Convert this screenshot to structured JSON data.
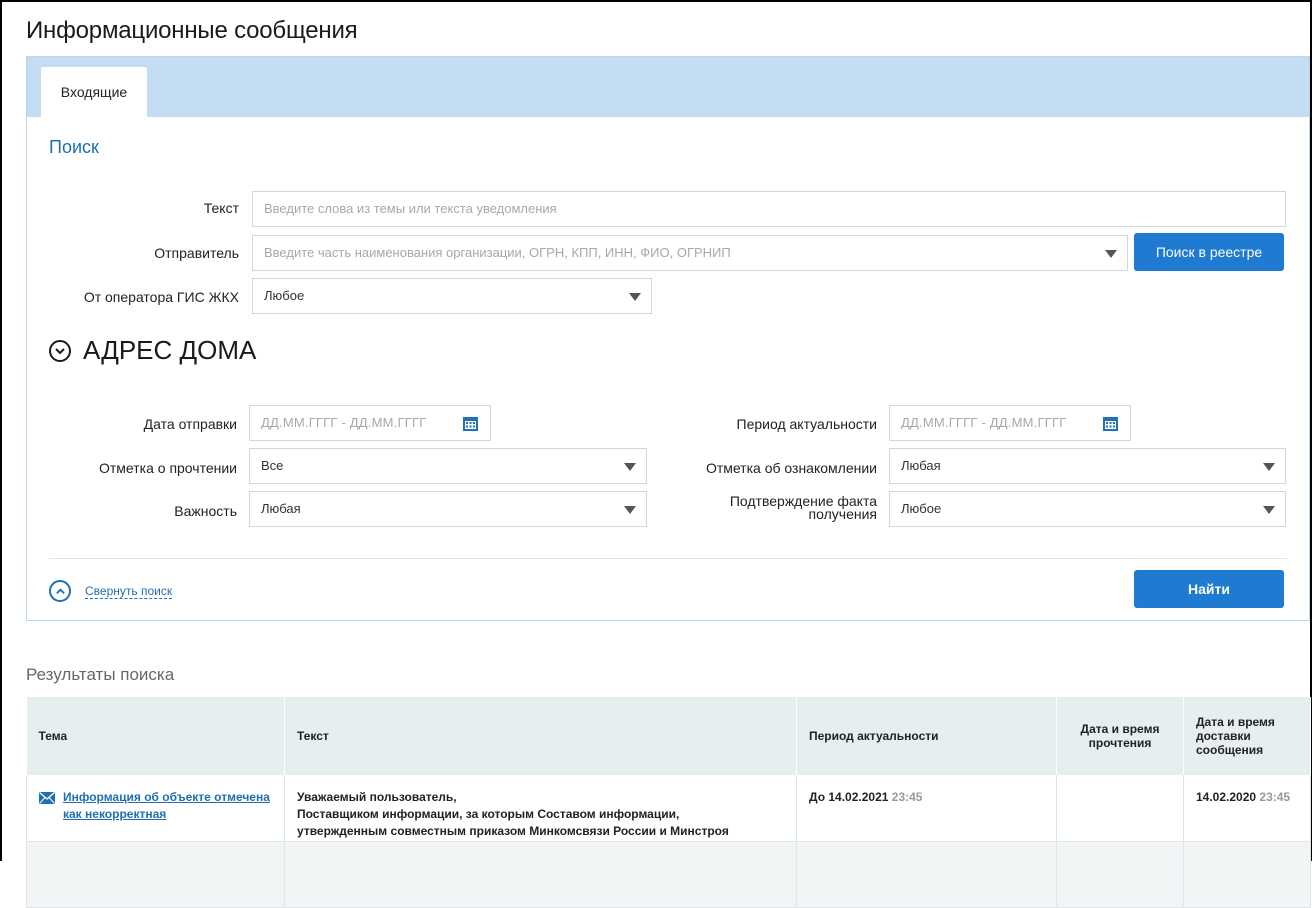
{
  "page": {
    "title": "Информационные сообщения"
  },
  "tabs": [
    {
      "label": "Входящие",
      "active": true
    }
  ],
  "search": {
    "title": "Поиск",
    "text": {
      "label": "Текст",
      "placeholder": "Введите слова из темы или текста уведомления"
    },
    "sender": {
      "label": "Отправитель",
      "placeholder": "Введите часть наименования организации, ОГРН, КПП, ИНН, ФИО, ОГРНИП"
    },
    "registry_button": "Поиск в реестре",
    "operator": {
      "label": "От оператора ГИС ЖКХ",
      "value": "Любое"
    },
    "address_section": "АДРЕС ДОМА",
    "send_date": {
      "label": "Дата отправки",
      "placeholder": "ДД.ММ.ГГГГ  -  ДД.ММ.ГГГГ"
    },
    "actuality_period": {
      "label": "Период актуальности",
      "placeholder": "ДД.ММ.ГГГГ  -  ДД.ММ.ГГГГ"
    },
    "read_mark": {
      "label": "Отметка о прочтении",
      "value": "Все"
    },
    "ack_mark": {
      "label": "Отметка об ознакомлении",
      "value": "Любая"
    },
    "importance": {
      "label": "Важность",
      "value": "Любая"
    },
    "receipt_confirm": {
      "label_line1": "Подтверждение факта",
      "label_line2": "получения",
      "value": "Любое"
    },
    "collapse_link": "Свернуть поиск",
    "find_button": "Найти"
  },
  "results": {
    "title": "Результаты поиска",
    "columns": [
      "Тема",
      "Текст",
      "Период актуальности",
      "Дата и время прочтения",
      "Дата и время доставки сообщения"
    ],
    "rows": [
      {
        "subject": "Информация об объекте отмечена как некорректная",
        "text_line1": "Уважаемый пользователь,",
        "text_line2": "Поставщиком информации, за которым Составом информации,",
        "text_line3": "утвержденным совместным приказом Минкомсвязи России и Минстроя",
        "period_prefix": "До 14.02.2021",
        "period_time": "23:45",
        "read_datetime": "",
        "delivery_date": "14.02.2020",
        "delivery_time": "23:45"
      }
    ]
  },
  "colors": {
    "accent": "#1f7ad1",
    "link": "#1f6fb5",
    "tabbar": "#c5ddf2"
  }
}
